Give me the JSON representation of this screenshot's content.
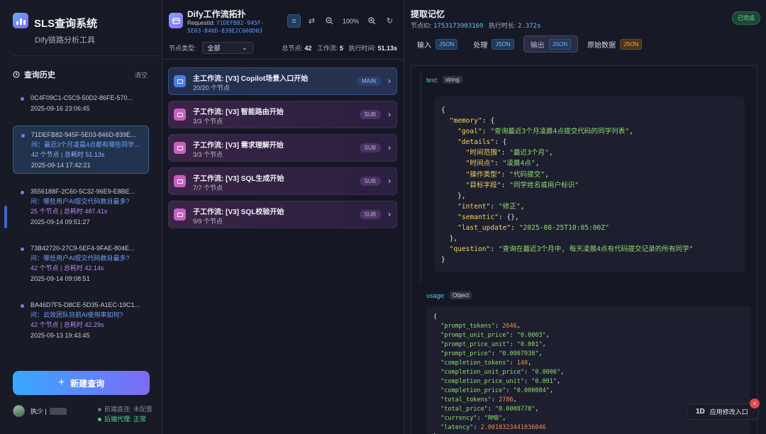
{
  "sidebar": {
    "brand_title": "SLS查询系统",
    "brand_subtitle": "Dify链路分析工具",
    "history_title": "查询历史",
    "clear_label": "清空",
    "items": [
      {
        "id": "0C4F09C1-C5C9-50D2-86FE-570...",
        "question": "",
        "stats": "",
        "time": "2025-09-16 23:06:45"
      },
      {
        "id": "71DEFB82-945F-5E03-846D-839E...",
        "question": "问：最近3个月凌晨4点都有哪些同学...",
        "stats": "42 个节点 | 总耗时 51.13s",
        "time": "2025-09-14 17:42:21"
      },
      {
        "id": "3556188F-2C60-5C32-96E9-E8BE...",
        "question": "问：哪些用户AI提交代码数目最多?",
        "stats": "25 个节点 | 总耗时 487.41s",
        "time": "2025-09-14 09:51:27"
      },
      {
        "id": "73B42720-27C9-5EF4-9FAE-804E...",
        "question": "问：哪些用户AI提交代码数目最多?",
        "stats": "42 个节点 | 总耗时 42.14s",
        "time": "2025-09-14 09:08:51"
      },
      {
        "id": "BA46D7F5-D8CE-5D35-A1EC-19C1...",
        "question": "问：云效团队目前AI使用率如何?",
        "stats": "42 个节点 | 总耗时 42.29s",
        "time": "2025-09-13 19:43:45"
      }
    ],
    "new_query_label": "新建查询",
    "user_name": "执少 |",
    "status_frontend": "前端直连: 未配置",
    "status_backend": "后端代理: 正常",
    "colors": {
      "accent": "#5e8de0",
      "ok": "#46d18a",
      "muted": "#6c7080"
    }
  },
  "topology": {
    "title": "Dify工作流拓扑",
    "request_label": "RequestId: ",
    "request_id_1": "71DEFB82-945F-",
    "request_id_2": "5E03-846D-839E2C660D03",
    "zoom": "100%",
    "filter_label": "节点类型:",
    "filter_value": "全部",
    "stat_nodes_label": "总节点: ",
    "stat_nodes": "42",
    "stat_flows_label": "工作流: ",
    "stat_flows": "5",
    "stat_time_label": "执行时间: ",
    "stat_time": "51.13s",
    "workflows": [
      {
        "name": "主工作流: [V3] Copilot场景入口开始",
        "count": "20/20 个节点",
        "badge": "MAIN"
      },
      {
        "name": "子工作流: [V3] 智能路由开始",
        "count": "3/3 个节点",
        "badge": "SUB"
      },
      {
        "name": "子工作流: [V3] 需求理解开始",
        "count": "3/3 个节点",
        "badge": "SUB"
      },
      {
        "name": "子工作流: [V3] SQL生成开始",
        "count": "7/7 个节点",
        "badge": "SUB"
      },
      {
        "name": "子工作流: [V3] SQL校验开始",
        "count": "9/9 个节点",
        "badge": "SUB"
      }
    ]
  },
  "output": {
    "title": "提取记忆",
    "node_id_label": "节点ID: ",
    "node_id": "1753173903169",
    "duration_label": "执行时长: ",
    "duration": "2.372s",
    "status": "已完成",
    "tabs": [
      {
        "label": "输入",
        "badge": "JSON"
      },
      {
        "label": "处理",
        "badge": "JSON"
      },
      {
        "label": "输出",
        "badge": "JSON"
      },
      {
        "label": "原始数据",
        "badge": "JSON"
      }
    ],
    "text_field": "text:",
    "text_type": "string",
    "usage_field": "usage:",
    "usage_type": "Object",
    "memory_json": {
      "goal": "查询最近3个月凌晨4点提交代码的同学列表",
      "time_range": "最近3个月",
      "time_point": "凌晨4点",
      "op_type": "代码提交",
      "target_field": "同学姓名或用户标识",
      "intent": "修正",
      "last_update": "2025-08-25T10:05:00Z",
      "question": "查询在最近3个月中, 每天凌晨4点有代码提交记录的所有同学"
    },
    "usage_json": {
      "prompt_tokens": "2646",
      "prompt_unit_price": "0.0003",
      "prompt_price_unit": "0.001",
      "prompt_price": "0.0007938",
      "completion_tokens": "140",
      "completion_unit_price": "0.0006",
      "completion_price_unit": "0.001",
      "completion_price": "0.000084",
      "total_tokens": "2786",
      "total_price": "0.0008778",
      "currency": "RMB",
      "latency": "2.0018323441036046"
    }
  },
  "floating": {
    "label": "应用修改入口",
    "logo": "1D",
    "close": "×"
  }
}
